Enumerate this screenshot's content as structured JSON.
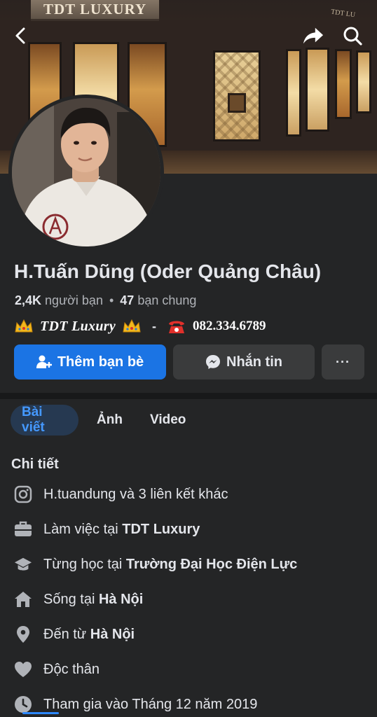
{
  "cover": {
    "store_sign": "TDT LUXURY",
    "side_sign": "TDT LU"
  },
  "profile": {
    "name": "H.Tuấn Dũng (Oder Quảng Châu)",
    "friends_count": "2,4K",
    "friends_label": "người bạn",
    "mutual_count": "47",
    "mutual_label": "bạn chung",
    "bio_brand": "TDT Luxury",
    "bio_dash": "-",
    "bio_phone": "082.334.6789"
  },
  "actions": {
    "add_friend": "Thêm bạn bè",
    "message": "Nhắn tin",
    "more": "···"
  },
  "tabs": [
    {
      "label": "Bài viết",
      "active": true
    },
    {
      "label": "Ảnh",
      "active": false
    },
    {
      "label": "Video",
      "active": false
    }
  ],
  "details": {
    "title": "Chi tiết",
    "items": [
      {
        "icon": "instagram-icon",
        "text": "H.tuandung và 3 liên kết khác",
        "bold": ""
      },
      {
        "icon": "briefcase-icon",
        "text": "Làm việc tại ",
        "bold": "TDT Luxury"
      },
      {
        "icon": "graduation-cap-icon",
        "text": "Từng học tại ",
        "bold": "Trường Đại Học Điện Lực"
      },
      {
        "icon": "home-icon",
        "text": "Sống tại ",
        "bold": "Hà Nội"
      },
      {
        "icon": "location-pin-icon",
        "text": "Đến từ ",
        "bold": "Hà Nội"
      },
      {
        "icon": "heart-icon",
        "text": "Độc thân",
        "bold": ""
      },
      {
        "icon": "clock-icon",
        "text": "Tham gia vào Tháng 12 năm 2019",
        "bold": ""
      }
    ]
  },
  "colors": {
    "background": "#242526",
    "primary_button": "#1b74e4",
    "secondary_button": "#3a3b3c",
    "active_tab_bg": "#263951",
    "active_tab_text": "#4599ff"
  }
}
